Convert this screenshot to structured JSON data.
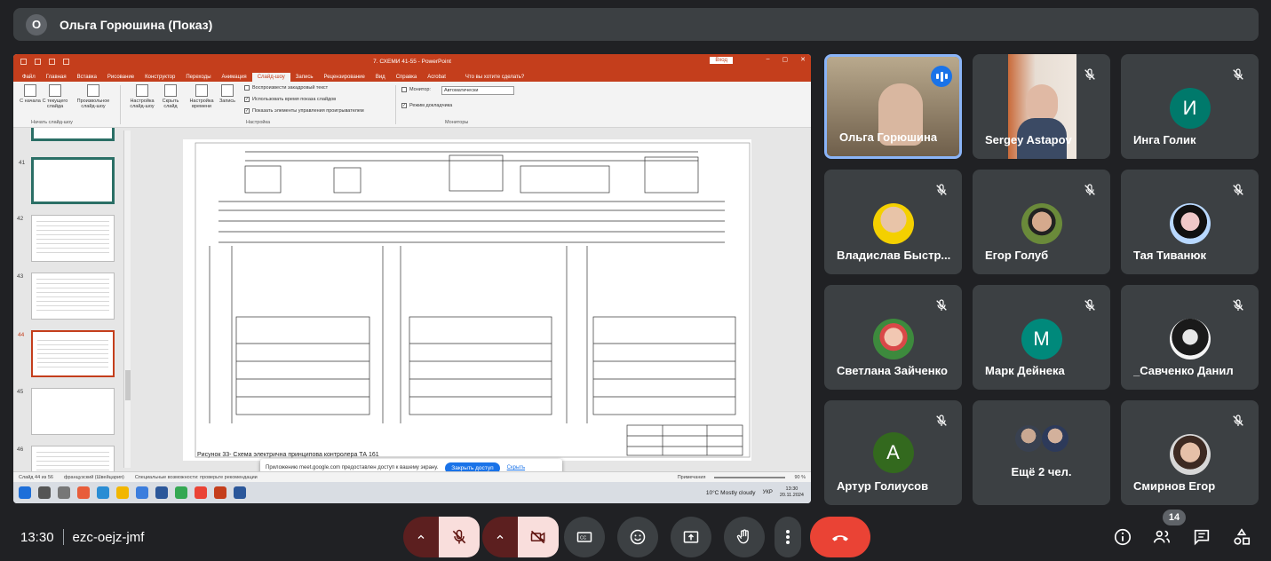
{
  "presenter_bar": {
    "avatar_letter": "О",
    "title": "Ольга Горюшина (Показ)"
  },
  "powerpoint": {
    "doc_title": "7. СХЕМИ 41-55 - PowerPoint",
    "sign_in": "Вход",
    "tabs": [
      "Файл",
      "Главная",
      "Вставка",
      "Рисование",
      "Конструктор",
      "Переходы",
      "Анимация",
      "Слайд-шоу",
      "Запись",
      "Рецензирование",
      "Вид",
      "Справка",
      "Acrobat"
    ],
    "active_tab": "Слайд-шоу",
    "tell_me": "Что вы хотите сделать?",
    "ribbon": {
      "start_buttons": [
        "С начала",
        "С текущего слайда",
        "Произвольное слайд-шоу"
      ],
      "start_group": "Начать слайд-шоу",
      "setup_buttons": [
        "Настройка слайд-шоу",
        "Скрыть слайд",
        "Настройка времени",
        "Запись"
      ],
      "checks": [
        {
          "label": "Воспроизвести закадровый текст",
          "checked": false
        },
        {
          "label": "Использовать время показа слайдов",
          "checked": true
        },
        {
          "label": "Показать элементы управления проигрывателем",
          "checked": true
        }
      ],
      "setup_group": "Настройка",
      "monitor_label": "Монитор:",
      "monitor_value": "Автоматически",
      "presenter_view": "Режим докладчика",
      "monitors_group": "Мониторы"
    },
    "thumbs": [
      "41",
      "42",
      "43",
      "44",
      "45",
      "46"
    ],
    "selected_thumb": "44",
    "slide_caption": "Рисунок 33- Схема электрична принципова контролера ТА 161",
    "notification": {
      "text": "Приложению meet.google.com предоставлен доступ к вашему экрану.",
      "button": "Закрыть доступ",
      "hide": "Скрыть"
    },
    "status": {
      "slide": "Слайд 44 из 56",
      "lang": "французский (Швейцария)",
      "accessibility": "Специальные возможности: проверьте рекомендации",
      "notes": "Примечания",
      "zoom": "90 %"
    },
    "taskbar": {
      "weather": "10°C  Mostly cloudy",
      "lang": "УКР",
      "time": "13:30",
      "date": "20.11.2024"
    }
  },
  "participants": [
    {
      "name": "Ольга Горюшина",
      "type": "video",
      "speaking": true
    },
    {
      "name": "Sergey Astapov",
      "type": "video",
      "muted": true
    },
    {
      "name": "Инга Голик",
      "type": "letter",
      "letter": "И",
      "color": "#00796b",
      "muted": true
    },
    {
      "name": "Владислав Быстр...",
      "type": "photo",
      "muted": true
    },
    {
      "name": "Егор Голуб",
      "type": "photo",
      "muted": true
    },
    {
      "name": "Тая Тиванюк",
      "type": "photo",
      "muted": true
    },
    {
      "name": "Светлана Зайченко",
      "type": "photo",
      "muted": true
    },
    {
      "name": "Марк Дейнека",
      "type": "letter",
      "letter": "М",
      "color": "#00897b",
      "muted": true
    },
    {
      "name": "_Савченко Данил",
      "type": "photo",
      "muted": true
    },
    {
      "name": "Артур Голиусов",
      "type": "letter",
      "letter": "А",
      "color": "#33691e",
      "muted": true
    },
    {
      "name": "Ещё 2 чел.",
      "type": "group"
    },
    {
      "name": "Смирнов Егор",
      "type": "photo",
      "muted": true
    }
  ],
  "footer": {
    "time": "13:30",
    "meeting_code": "ezc-oejz-jmf",
    "people_count": "14"
  },
  "colors": {
    "end_call": "#ea4335",
    "muted_bg": "#f9dedc",
    "tile_bg": "#3c4043",
    "accent": "#1a73e8"
  }
}
